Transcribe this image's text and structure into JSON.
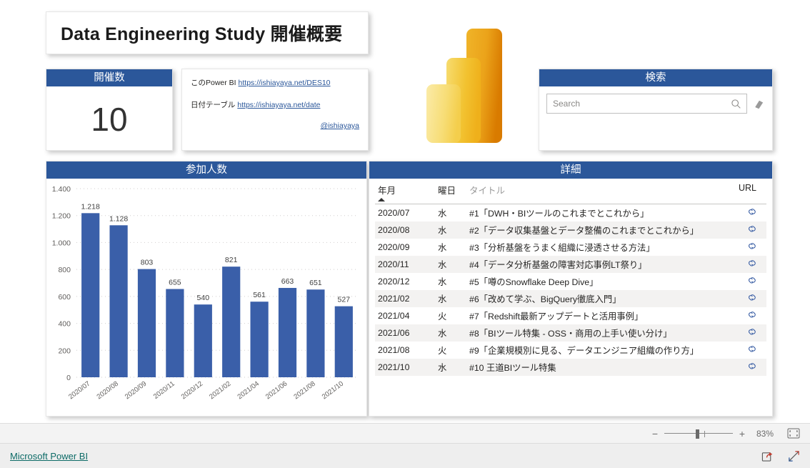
{
  "report": {
    "title": "Data Engineering Study 開催概要"
  },
  "kpi": {
    "header": "開催数",
    "value": "10"
  },
  "links": {
    "line1_label": "このPower BI",
    "line1_url": "https://ishiayaya.net/DES10",
    "line2_label": "日付テーブル",
    "line2_url": "https://ishiayaya.net/date",
    "handle": "@ishiayaya"
  },
  "search": {
    "header": "検索",
    "placeholder": "Search",
    "value": "",
    "search_icon": "search-icon",
    "clear_icon": "eraser-icon"
  },
  "logo": {
    "name": "power-bi-logo",
    "color_light": "#F2C94C",
    "color_mid": "#EEB111",
    "color_dark": "#E08A00"
  },
  "chart_panel": {
    "header": "参加人数"
  },
  "chart_data": {
    "type": "bar",
    "title": "参加人数",
    "xlabel": "",
    "ylabel": "",
    "categories": [
      "2020/07",
      "2020/08",
      "2020/09",
      "2020/11",
      "2020/12",
      "2021/02",
      "2021/04",
      "2021/06",
      "2021/08",
      "2021/10"
    ],
    "values": [
      1218,
      1128,
      803,
      655,
      540,
      821,
      561,
      663,
      651,
      527
    ],
    "data_labels": [
      "1.218",
      "1.128",
      "803",
      "655",
      "540",
      "821",
      "561",
      "663",
      "651",
      "527"
    ],
    "ylim": [
      0,
      1400
    ],
    "yticks": [
      0,
      200,
      400,
      600,
      800,
      1000,
      1200,
      1400
    ],
    "ytick_labels": [
      "0",
      "200",
      "400",
      "600",
      "800",
      "1.000",
      "1.200",
      "1.400"
    ],
    "grid": true,
    "legend": "none",
    "bar_color": "#3A5FA9"
  },
  "table_panel": {
    "header": "詳細",
    "columns": [
      "年月",
      "曜日",
      "タイトル",
      "URL"
    ],
    "sort_column": "年月",
    "sort_direction": "ascending",
    "url_icon": "link-icon",
    "rows": [
      {
        "ym": "2020/07",
        "dow": "水",
        "title": "#1「DWH・BIツールのこれまでとこれから」"
      },
      {
        "ym": "2020/08",
        "dow": "水",
        "title": "#2「データ収集基盤とデータ整備のこれまでとこれから」"
      },
      {
        "ym": "2020/09",
        "dow": "水",
        "title": "#3「分析基盤をうまく組織に浸透させる方法」"
      },
      {
        "ym": "2020/11",
        "dow": "水",
        "title": "#4「データ分析基盤の障害対応事例LT祭り」"
      },
      {
        "ym": "2020/12",
        "dow": "水",
        "title": "#5「噂のSnowflake Deep Dive」"
      },
      {
        "ym": "2021/02",
        "dow": "水",
        "title": "#6「改めて学ぶ、BigQuery徹底入門」"
      },
      {
        "ym": "2021/04",
        "dow": "火",
        "title": "#7「Redshift最新アップデートと活用事例」"
      },
      {
        "ym": "2021/06",
        "dow": "水",
        "title": "#8「BIツール特集 - OSS・商用の上手い使い分け」"
      },
      {
        "ym": "2021/08",
        "dow": "火",
        "title": "#9「企業規模別に見る、データエンジニア組織の作り方」"
      },
      {
        "ym": "2021/10",
        "dow": "水",
        "title": "#10 王道BIツール特集"
      }
    ]
  },
  "zoombar": {
    "minus": "−",
    "plus": "+",
    "percent": "83%",
    "fit_icon": "fit-to-page-icon"
  },
  "statusbar": {
    "link": "Microsoft Power BI",
    "share_icon": "share-icon",
    "fullscreen_icon": "fullscreen-icon"
  },
  "theme": {
    "header_blue": "#2b579a",
    "bar_blue": "#3A5FA9",
    "link_teal": "#0d6b67"
  }
}
